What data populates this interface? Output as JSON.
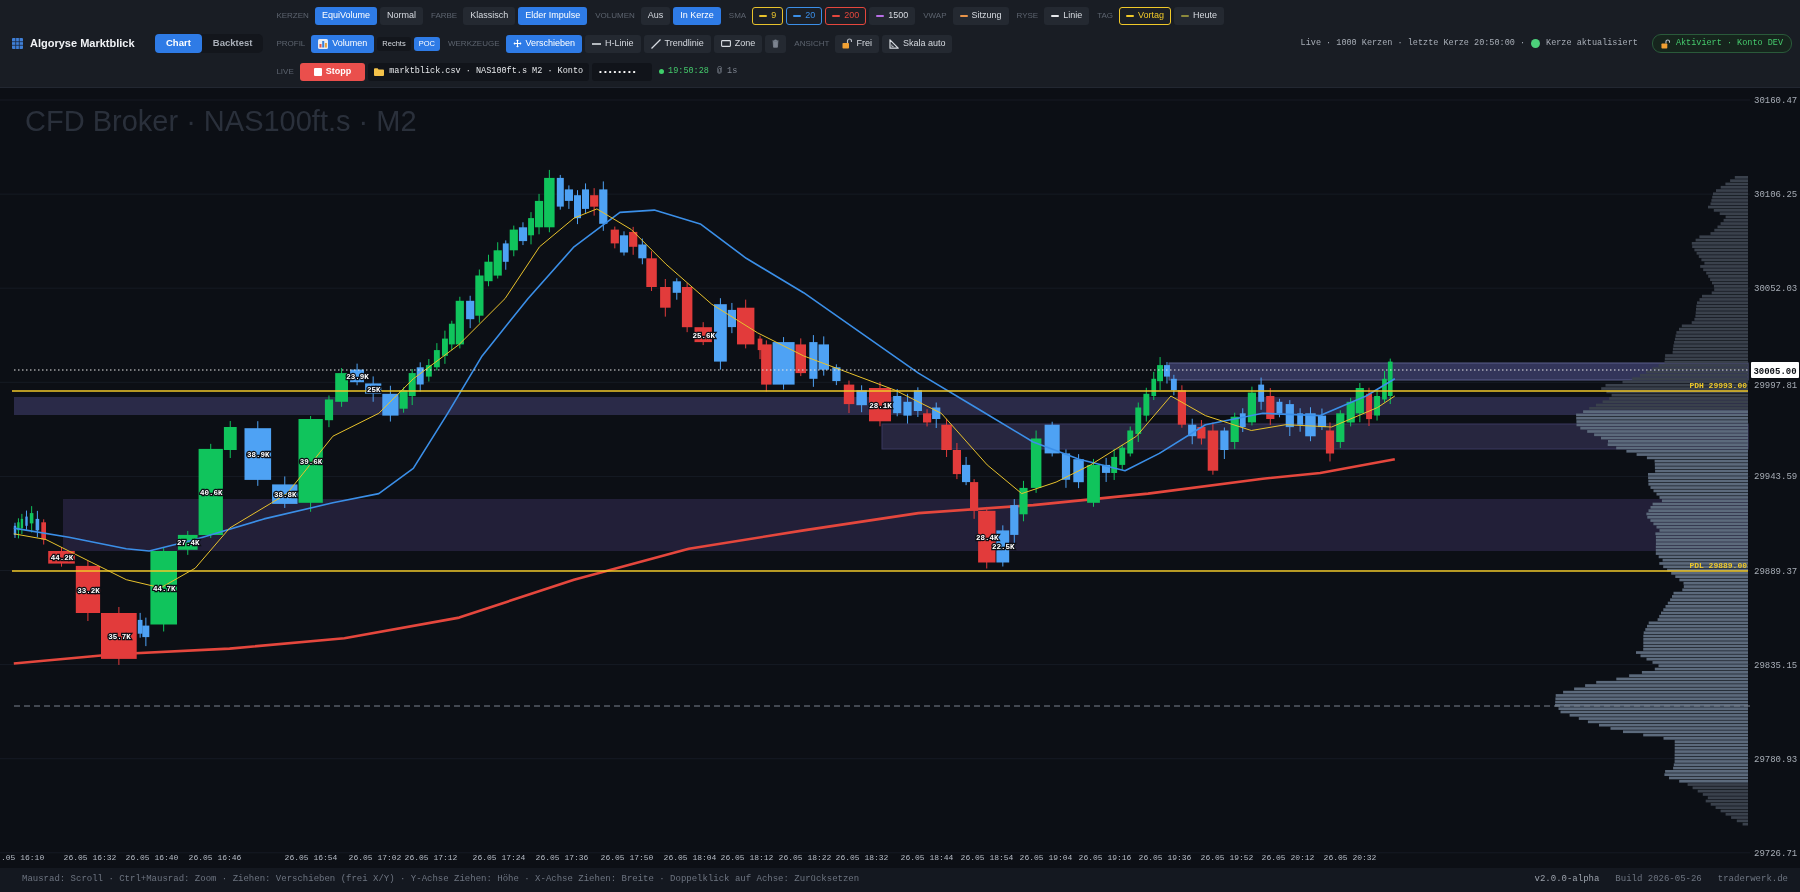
{
  "app": {
    "title": "Algoryse Marktblick"
  },
  "tabs": [
    {
      "label": "Chart",
      "selected": true
    },
    {
      "label": "Backtest",
      "selected": false
    }
  ],
  "toolbar": [
    [
      {
        "label": "KERZEN",
        "buttons": [
          {
            "kind": "text",
            "label": "EquiVolume",
            "selected": true
          },
          {
            "kind": "text",
            "label": "Normal",
            "selected": false
          }
        ]
      },
      {
        "label": "FARBE",
        "buttons": [
          {
            "kind": "text",
            "label": "Klassisch",
            "selected": false
          },
          {
            "kind": "text",
            "label": "Elder Impulse",
            "selected": true
          }
        ]
      },
      {
        "label": "VOLUMEN",
        "buttons": [
          {
            "kind": "text",
            "label": "Aus",
            "selected": false
          },
          {
            "kind": "text",
            "label": "In Kerze",
            "selected": true
          }
        ]
      },
      {
        "label": "SMA",
        "buttons": [
          {
            "kind": "swatch",
            "label": "9",
            "selected": true,
            "color": "#e8c22c"
          },
          {
            "kind": "swatch",
            "label": "20",
            "selected": true,
            "color": "#3b8fe8"
          },
          {
            "kind": "swatch",
            "label": "200",
            "selected": true,
            "color": "#e5473d"
          },
          {
            "kind": "swatch",
            "label": "1500",
            "selected": false,
            "color": "#b86ee6"
          }
        ]
      },
      {
        "label": "VWAP",
        "buttons": [
          {
            "kind": "swatch",
            "label": "Sitzung",
            "selected": false,
            "color": "#e8944a"
          }
        ]
      },
      {
        "label": "RYSE",
        "buttons": [
          {
            "kind": "swatch",
            "label": "Linie",
            "selected": false,
            "color": "#e6e8ec"
          }
        ]
      },
      {
        "label": "TAG",
        "buttons": [
          {
            "kind": "swatch",
            "label": "Vortag",
            "selected": true,
            "color": "#f0c929"
          },
          {
            "kind": "swatch",
            "label": "Heute",
            "selected": false,
            "color": "#8c8a3c"
          }
        ]
      }
    ],
    [
      {
        "label": "PROFIL",
        "buttons": [
          {
            "kind": "icon",
            "label": "Volumen",
            "selected": true
          },
          {
            "kind": "small",
            "label": "Rechts",
            "selected": false
          },
          {
            "kind": "small",
            "label": "POC",
            "selected": true
          }
        ]
      },
      {
        "label": "WERKZEUGE",
        "buttons": [
          {
            "kind": "icon",
            "label": "Verschieben",
            "selected": true
          },
          {
            "kind": "icon",
            "label": "H-Linie",
            "selected": false
          },
          {
            "kind": "icon",
            "label": "Trendlinie",
            "selected": false
          },
          {
            "kind": "icon",
            "label": "Zone",
            "selected": false
          },
          {
            "kind": "icon",
            "selected": false
          }
        ]
      },
      {
        "label": "ANSICHT",
        "buttons": [
          {
            "kind": "icon",
            "label": "Frei",
            "selected": false
          },
          {
            "kind": "icon",
            "label": "Skala auto",
            "selected": false
          }
        ]
      }
    ]
  ],
  "live_bar": {
    "label": "LIVE",
    "stop_button": "Stopp",
    "source": "marktblick.csv · NAS100ft.s M2 · Konto",
    "password": "••••••••",
    "clock": "19:50:28",
    "interval": "@ 1s"
  },
  "live_status": {
    "summary": "Live · 1000 Kerzen · letzte Kerze 20:50:00 ·",
    "update": "Kerze aktualisiert",
    "badge": "Aktiviert · Konto DEV"
  },
  "chart": {
    "watermark": "CFD Broker · NAS100ft.s · M2",
    "price_ticks": [
      "30160.47",
      "30106.25",
      "30052.03",
      "29997.81",
      "29943.59",
      "29889.37",
      "29835.15",
      "29780.93",
      "29726.71"
    ],
    "time_ticks": [
      ".05 16:10",
      "26.05 16:32",
      "26.05 16:40",
      "26.05 16:46",
      "26.05 16:54",
      "26.05 17:02",
      "26.05 17:12",
      "26.05 17:24",
      "26.05 17:36",
      "26.05 17:50",
      "26.05 18:04",
      "26.05 18:12",
      "26.05 18:22",
      "26.05 18:32",
      "26.05 18:44",
      "26.05 18:54",
      "26.05 19:04",
      "26.05 19:16",
      "26.05 19:36",
      "26.05 19:52",
      "26.05 20:12",
      "26.05 20:32"
    ],
    "last_price": "30005.00",
    "levels": [
      {
        "label": "PDH 29993.00"
      },
      {
        "label": "PDL 29889.00"
      }
    ],
    "volume_labels": [
      "44.2K",
      "33.2K",
      "35.7K",
      "44.7K",
      "27.4K",
      "40.6K",
      "38.9K",
      "38.8K",
      "39.6K",
      "23.9K",
      "25K",
      "25.6K",
      "28.1K",
      "28.4K",
      "22.5K"
    ]
  },
  "status_bar": {
    "hint": "Mausrad: Scroll · Ctrl+Mausrad: Zoom · Ziehen: Verschieben (frei X/Y) · Y-Achse Ziehen: Höhe · X-Achse Ziehen: Breite · Doppelklick auf Achse: Zurücksetzen",
    "version": "v2.0.0-alpha",
    "build": "Build 2026-05-26",
    "site": "traderwerk.de"
  }
}
